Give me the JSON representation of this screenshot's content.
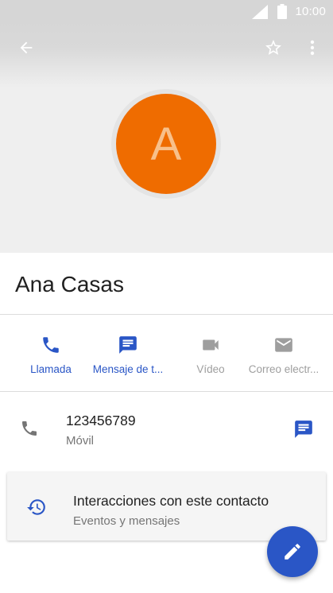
{
  "status_bar": {
    "time": "10:00"
  },
  "contact": {
    "initial": "A",
    "name": "Ana Casas",
    "avatar_color": "#ef6c00"
  },
  "actions": [
    {
      "label": "Llamada",
      "icon": "phone-icon",
      "enabled": true
    },
    {
      "label": "Mensaje de t...",
      "icon": "message-icon",
      "enabled": true
    },
    {
      "label": "Vídeo",
      "icon": "video-icon",
      "enabled": false
    },
    {
      "label": "Correo electr...",
      "icon": "email-icon",
      "enabled": false
    }
  ],
  "phone": {
    "number": "123456789",
    "type": "Móvil"
  },
  "interactions": {
    "title": "Interacciones con este contacto",
    "subtitle": "Eventos y mensajes"
  },
  "colors": {
    "accent": "#2a56c6",
    "disabled": "#9e9e9e",
    "header_bg": "#efefef"
  }
}
